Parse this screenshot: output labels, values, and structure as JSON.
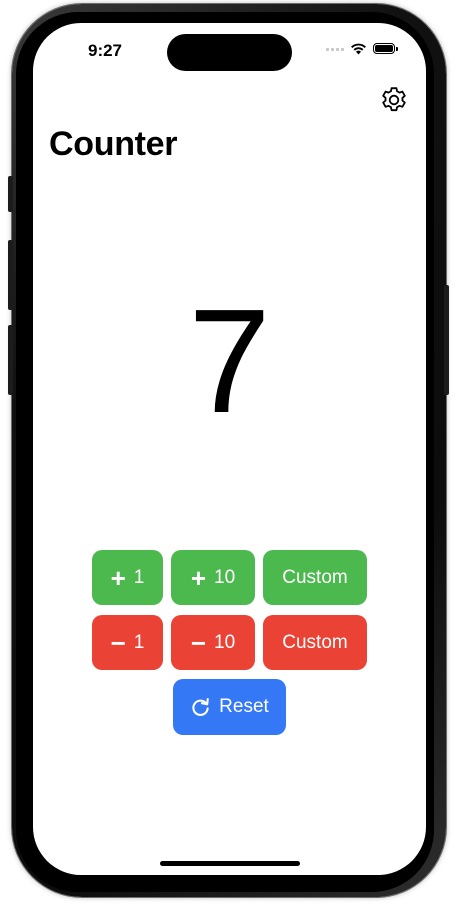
{
  "status_bar": {
    "time": "9:27"
  },
  "header": {
    "title": "Counter"
  },
  "counter": {
    "value": "7"
  },
  "increment_buttons": [
    {
      "sign": "+",
      "amount": "1"
    },
    {
      "sign": "+",
      "amount": "10"
    },
    {
      "label": "Custom"
    }
  ],
  "decrement_buttons": [
    {
      "sign": "−",
      "amount": "1"
    },
    {
      "sign": "−",
      "amount": "10"
    },
    {
      "label": "Custom"
    }
  ],
  "reset": {
    "label": "Reset"
  },
  "icons": {
    "settings": "gear-icon",
    "reset": "arrow-clockwise-icon",
    "wifi": "wifi-icon",
    "battery": "battery-icon",
    "signal": "cellular-signal-icon"
  },
  "colors": {
    "increment": "#4cb94f",
    "decrement": "#ea4335",
    "reset": "#3478f6"
  }
}
